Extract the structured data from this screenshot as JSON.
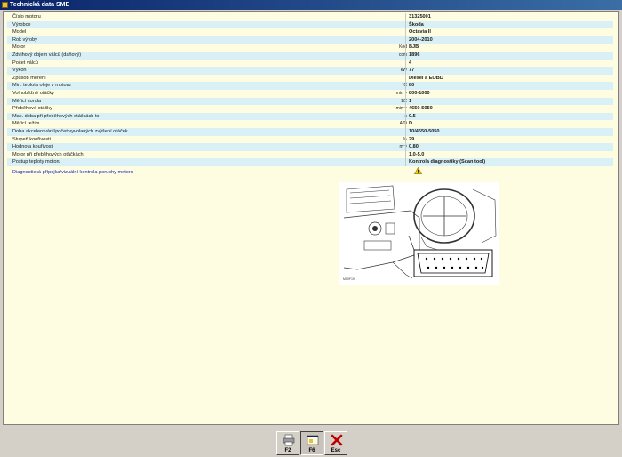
{
  "window": {
    "title": "Technická data SME"
  },
  "rows": [
    {
      "label": "Číslo motoru",
      "unit": "",
      "value": "31325001"
    },
    {
      "label": "Výrobce",
      "unit": "",
      "value": "Škoda"
    },
    {
      "label": "Model",
      "unit": "",
      "value": "Octavia II"
    },
    {
      "label": "Rok výroby",
      "unit": "",
      "value": "2004-2010"
    },
    {
      "label": "Motor",
      "unit": "Kód",
      "value": "BJB"
    },
    {
      "label": "Zdvihový objem válců (daňový)",
      "unit": "ccm",
      "value": "1896"
    },
    {
      "label": "Počet válců",
      "unit": "",
      "value": "4"
    },
    {
      "label": "Výkon",
      "unit": "kW",
      "value": "77"
    },
    {
      "label": "Způsob měření",
      "unit": "",
      "value": "Diesel a EOBD"
    },
    {
      "label": "Min. teplota oleje v motoru",
      "unit": "°C",
      "value": "80"
    },
    {
      "label": "Volnoběžné otáčky",
      "unit": "min⁻¹",
      "value": "800-1000"
    },
    {
      "label": "Měřicí sonda",
      "unit": "1/2",
      "value": "1"
    },
    {
      "label": "Přeběhové otáčky",
      "unit": "min⁻¹",
      "value": "4650-5050"
    },
    {
      "label": "Max. doba při přeběhových otáčkách tx",
      "unit": "s",
      "value": "0.5"
    },
    {
      "label": "Měřicí režim",
      "unit": "A/D",
      "value": "D"
    },
    {
      "label": "Doba akcelerování/počet vyvolaných zvýšení otáček",
      "unit": "",
      "value": "10/4650-5050"
    },
    {
      "label": "Stupeň kouřivosti",
      "unit": "%",
      "value": "29"
    },
    {
      "label": "Hodnota kouřivosti",
      "unit": "m⁻¹",
      "value": "0.80"
    },
    {
      "label": "Motor při přeběhových otáčkách",
      "unit": "",
      "value": "1.0-5.0"
    },
    {
      "label": "Postup teploty motoru",
      "unit": "",
      "value": "Kontrola diagnostiky (Scan tool)"
    }
  ],
  "diagnostic_link": "Diagnostická přípojka/vizuální kontrola poruchy motoru",
  "diagram": {
    "image_code": "M00F19"
  },
  "toolbar": {
    "buttons": [
      {
        "key": "F2",
        "icon": "printer-icon"
      },
      {
        "key": "F6",
        "icon": "window-icon"
      },
      {
        "key": "Esc",
        "icon": "close-icon"
      }
    ]
  },
  "colors": {
    "content_bg": "#fffde1",
    "alt_row": "#d8f0f6",
    "link": "#2020c0",
    "title_bar": "#0a246a"
  }
}
